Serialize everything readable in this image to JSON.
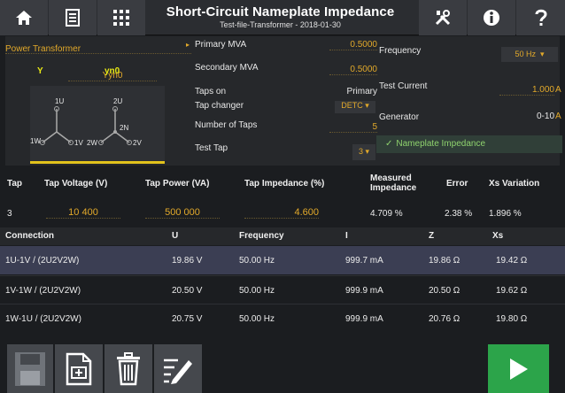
{
  "header": {
    "title": "Short-Circuit Nameplate Impedance",
    "subtitle": "Test-file-Transformer - 2018-01-30",
    "icons": [
      "home-icon",
      "document-icon",
      "grid-icon",
      "tools-icon",
      "info-icon",
      "help-icon"
    ]
  },
  "config": {
    "device_type": "Power Transformer",
    "vector_group": "Yyn0",
    "diagram": {
      "primary_label": "Y",
      "secondary_label": "yn0",
      "terminals": [
        "1U",
        "2U",
        "1W",
        "1V",
        "2W",
        "2N",
        "2V"
      ]
    },
    "primary_mva_label": "Primary MVA",
    "primary_mva": "0.5000",
    "secondary_mva_label": "Secondary MVA",
    "secondary_mva": "0.5000",
    "taps_on_label": "Taps on",
    "taps_on": "Primary",
    "tap_changer_label": "Tap changer",
    "tap_changer": "DETC",
    "number_of_taps_label": "Number of Taps",
    "number_of_taps": "5",
    "test_tap_label": "Test Tap",
    "test_tap": "3",
    "frequency_label": "Frequency",
    "frequency": "50 Hz",
    "test_current_label": "Test Current",
    "test_current": "1.000",
    "test_current_unit": "A",
    "generator_label": "Generator",
    "generator": "0-10",
    "generator_unit": "A",
    "nameplate_button": "Nameplate Impedance"
  },
  "results": {
    "headers": {
      "tap": "Tap",
      "tap_voltage": "Tap Voltage (V)",
      "tap_power": "Tap Power (VA)",
      "tap_impedance": "Tap Impedance (%)",
      "measured_1": "Measured",
      "measured_2": "Impedance",
      "error": "Error",
      "xs_variation": "Xs Variation"
    },
    "values": {
      "tap": "3",
      "tap_voltage": "10 400",
      "tap_power": "500 000",
      "tap_impedance": "4.600",
      "measured": "4.709 %",
      "error": "2.38 %",
      "xs_variation": "1.896 %"
    }
  },
  "table": {
    "columns": [
      "Connection",
      "U",
      "Frequency",
      "I",
      "Z",
      "Xs"
    ],
    "rows": [
      [
        "1U-1V / (2U2V2W)",
        "19.86 V",
        "50.00 Hz",
        "999.7 mA",
        "19.86 Ω",
        "19.42 Ω"
      ],
      [
        "1V-1W / (2U2V2W)",
        "20.50 V",
        "50.00 Hz",
        "999.9 mA",
        "20.50 Ω",
        "19.62 Ω"
      ],
      [
        "1W-1U / (2U2V2W)",
        "20.75 V",
        "50.00 Hz",
        "999.9 mA",
        "20.76 Ω",
        "19.80 Ω"
      ]
    ],
    "selected_row": 0
  },
  "toolbar": {
    "icons": [
      "save-icon",
      "new-file-icon",
      "delete-icon",
      "edit-icon",
      "play-icon"
    ]
  },
  "colors": {
    "accent": "#e2a92a",
    "run": "#2ca44a",
    "selected_row": "#3b3e53",
    "nameplate_text": "#8fd36e"
  }
}
